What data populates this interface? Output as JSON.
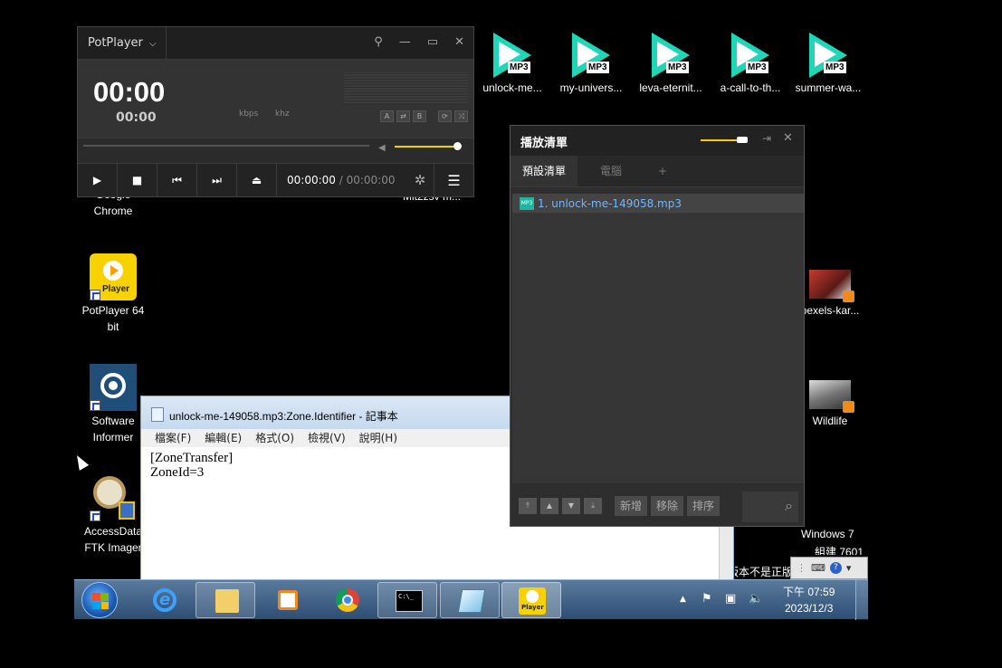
{
  "desktop": {
    "top_icons": [
      {
        "label": "unlock-me...",
        "badge": "MP3"
      },
      {
        "label": "my-univers...",
        "badge": "MP3"
      },
      {
        "label": "leva-eternit...",
        "badge": "MP3"
      },
      {
        "label": "a-call-to-th...",
        "badge": "MP3"
      },
      {
        "label": "summer-wa...",
        "badge": "MP3"
      }
    ],
    "left_icons": [
      {
        "label": "Google Chrome"
      },
      {
        "label": "PotPlayer 64 bit",
        "badge": "Player"
      },
      {
        "label": "Software Informer"
      },
      {
        "label": "AccessData FTK Imager"
      }
    ],
    "hidden_label": "Mit2zsv m...",
    "right_icons": [
      {
        "label": "pexels-kar..."
      },
      {
        "label": "Wildlife"
      }
    ],
    "watermark": {
      "line1": "Windows 7",
      "line2": "組建 7601",
      "line3": "此 Windows 版本不是正版"
    }
  },
  "potplayer": {
    "title": "PotPlayer",
    "title_arrow": "⌵",
    "big_time": "00:00",
    "small_time": "00:00",
    "kbps": "kbps",
    "khz": "khz",
    "mode_buttons": [
      "A",
      "⇄",
      "B",
      "⟳",
      "⤨"
    ],
    "window_buttons": [
      "⚲",
      "—",
      "▭",
      "✕"
    ],
    "current_time": "00:00:00",
    "separator": " / ",
    "total_time": "00:00:00",
    "controls": [
      "▶",
      "■",
      "⏮",
      "⏭",
      "⏏"
    ],
    "volume_fraction": 0.9
  },
  "playlist": {
    "title": "播放清單",
    "tabs": [
      "預設清單",
      "電腦",
      "+"
    ],
    "items": [
      "1. unlock-me-149058.mp3"
    ],
    "mini_badge": "MP3",
    "nav_buttons": [
      "⤒",
      "▲",
      "▼",
      "⤓"
    ],
    "buttons": [
      "新增",
      "移除",
      "排序"
    ],
    "search_icon": "⌕"
  },
  "notepad": {
    "title": "unlock-me-149058.mp3:Zone.Identifier - 記事本",
    "menu": [
      "檔案(F)",
      "編輯(E)",
      "格式(O)",
      "檢視(V)",
      "說明(H)"
    ],
    "content": "[ZoneTransfer]\nZoneId=3"
  },
  "langbar": {
    "icons": [
      "⌨",
      "?",
      "▾"
    ]
  },
  "taskbar": {
    "apps": [
      "internet-explorer",
      "file-explorer",
      "potplayer-alt",
      "chrome",
      "command-prompt",
      "notepad",
      "potplayer"
    ],
    "potplayer_badge": "Player",
    "tray_arrow": "▲",
    "clock_time": "下午 07:59",
    "clock_date": "2023/12/3"
  }
}
